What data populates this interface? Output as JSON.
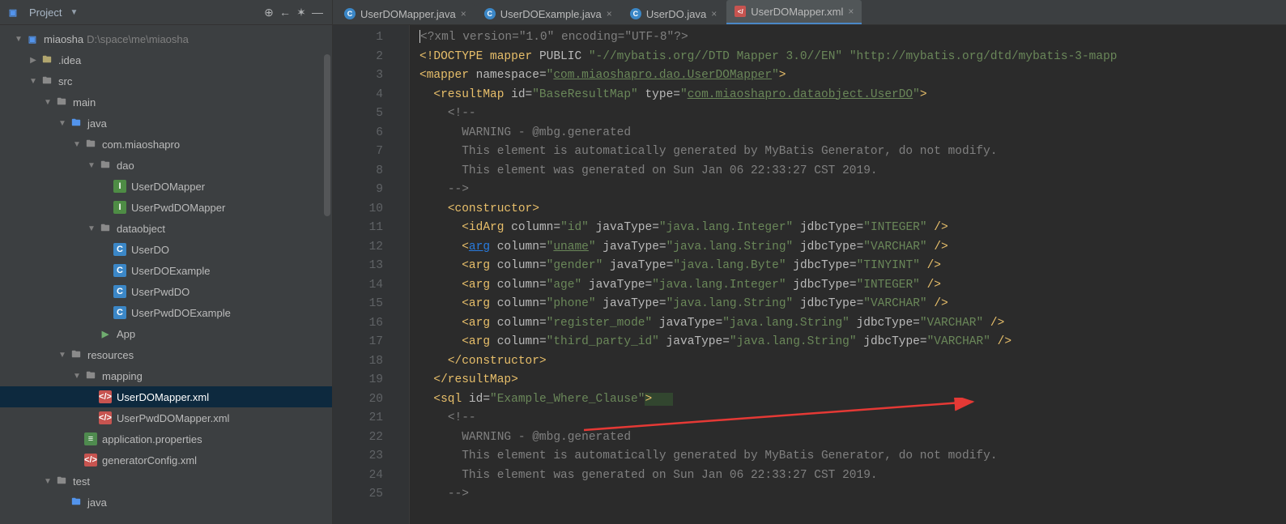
{
  "panel": {
    "title": "Project",
    "toolbar": {
      "target": "⊕",
      "back": "←",
      "gear": "✶",
      "min": "—"
    }
  },
  "tree": [
    {
      "d": 0,
      "exp": "▼",
      "icon": "mod",
      "label": "miaosha",
      "path": "D:\\space\\me\\miaosha",
      "sel": false
    },
    {
      "d": 1,
      "exp": "▶",
      "icon": "folderx",
      "label": ".idea"
    },
    {
      "d": 1,
      "exp": "▼",
      "icon": "folder",
      "label": "src"
    },
    {
      "d": 2,
      "exp": "▼",
      "icon": "folder",
      "label": "main"
    },
    {
      "d": 3,
      "exp": "▼",
      "icon": "folderb",
      "label": "java"
    },
    {
      "d": 4,
      "exp": "▼",
      "icon": "pkg",
      "label": "com.miaoshapro"
    },
    {
      "d": 5,
      "exp": "▼",
      "icon": "pkg",
      "label": "dao"
    },
    {
      "d": 6,
      "exp": "",
      "icon": "j",
      "label": "UserDOMapper"
    },
    {
      "d": 6,
      "exp": "",
      "icon": "j",
      "label": "UserPwdDOMapper"
    },
    {
      "d": 5,
      "exp": "▼",
      "icon": "pkg",
      "label": "dataobject"
    },
    {
      "d": 6,
      "exp": "",
      "icon": "c",
      "label": "UserDO"
    },
    {
      "d": 6,
      "exp": "",
      "icon": "c",
      "label": "UserDOExample"
    },
    {
      "d": 6,
      "exp": "",
      "icon": "c",
      "label": "UserPwdDO"
    },
    {
      "d": 6,
      "exp": "",
      "icon": "c",
      "label": "UserPwdDOExample"
    },
    {
      "d": 5,
      "exp": "",
      "icon": "app",
      "label": "App"
    },
    {
      "d": 3,
      "exp": "▼",
      "icon": "pkg",
      "label": "resources"
    },
    {
      "d": 4,
      "exp": "▼",
      "icon": "pkg",
      "label": "mapping"
    },
    {
      "d": 5,
      "exp": "",
      "icon": "x",
      "label": "UserDOMapper.xml",
      "sel": true
    },
    {
      "d": 5,
      "exp": "",
      "icon": "x",
      "label": "UserPwdDOMapper.xml"
    },
    {
      "d": 4,
      "exp": "",
      "icon": "prop",
      "label": "application.properties"
    },
    {
      "d": 4,
      "exp": "",
      "icon": "x",
      "label": "generatorConfig.xml"
    },
    {
      "d": 2,
      "exp": "▼",
      "icon": "folder",
      "label": "test"
    },
    {
      "d": 3,
      "exp": "",
      "icon": "folderb",
      "label": "java"
    }
  ],
  "tabs": [
    {
      "icon": "j",
      "label": "UserDOMapper.java",
      "active": false
    },
    {
      "icon": "j",
      "label": "UserDOExample.java",
      "active": false
    },
    {
      "icon": "j",
      "label": "UserDO.java",
      "active": false
    },
    {
      "icon": "x",
      "label": "UserDOMapper.xml",
      "active": true
    }
  ],
  "gutter": {
    "start": 1,
    "end": 25
  },
  "code": [
    {
      "n": 1,
      "t": "pi",
      "txt": "<?xml version=\"1.0\" encoding=\"UTF-8\"?>"
    },
    {
      "n": 2,
      "html": "<span class='tag'>&lt;!DOCTYPE mapper</span> <span class='attr'>PUBLIC</span> <span class='str'>\"-//mybatis.org//DTD Mapper 3.0//EN\"</span> <span class='str'>\"http://mybatis.org/dtd/mybatis-3-mapp</span>"
    },
    {
      "n": 3,
      "html": "<span class='tag'>&lt;mapper</span> <span class='attr'>namespace=</span><span class='str'>\"<span class='underline'>com.miaoshapro.dao.UserDOMapper</span>\"</span><span class='tag'>&gt;</span>"
    },
    {
      "n": 4,
      "html": "  <span class='tag'>&lt;resultMap</span> <span class='attr'>id=</span><span class='str'>\"BaseResultMap\"</span> <span class='attr'>type=</span><span class='str'>\"<span class='underline'>com.miaoshapro.dataobject.UserDO</span>\"</span><span class='tag'>&gt;</span>"
    },
    {
      "n": 5,
      "html": "    <span class='comment'>&lt;!--</span>"
    },
    {
      "n": 6,
      "html": "<span class='comment'>      WARNING - @mbg.generated</span>"
    },
    {
      "n": 7,
      "html": "<span class='comment'>      This element is automatically generated by MyBatis Generator, do not modify.</span>"
    },
    {
      "n": 8,
      "html": "<span class='comment'>      This element was generated on Sun Jan 06 22:33:27 CST 2019.</span>"
    },
    {
      "n": 9,
      "html": "    <span class='comment'>--&gt;</span>"
    },
    {
      "n": 10,
      "html": "    <span class='tag'>&lt;constructor&gt;</span>"
    },
    {
      "n": 11,
      "html": "      <span class='tag'>&lt;idArg</span> <span class='attr'>column=</span><span class='str'>\"id\"</span> <span class='attr'>javaType=</span><span class='str'>\"java.lang.Integer\"</span> <span class='attr'>jdbcType=</span><span class='str'>\"INTEGER\"</span> <span class='tag'>/&gt;</span>"
    },
    {
      "n": 12,
      "html": "      <span class='tag'>&lt;</span><span class='link'>arg</span> <span class='attr'>column=</span><span class='str'>\"<span class='underline'>uname</span>\"</span> <span class='attr'>javaType=</span><span class='str'>\"java.lang.String\"</span> <span class='attr'>jdbcType=</span><span class='str'>\"VARCHAR\"</span> <span class='tag'>/&gt;</span>"
    },
    {
      "n": 13,
      "html": "      <span class='tag'>&lt;arg</span> <span class='attr'>column=</span><span class='str'>\"gender\"</span> <span class='attr'>javaType=</span><span class='str'>\"java.lang.Byte\"</span> <span class='attr'>jdbcType=</span><span class='str'>\"TINYINT\"</span> <span class='tag'>/&gt;</span>"
    },
    {
      "n": 14,
      "html": "      <span class='tag'>&lt;arg</span> <span class='attr'>column=</span><span class='str'>\"age\"</span> <span class='attr'>javaType=</span><span class='str'>\"java.lang.Integer\"</span> <span class='attr'>jdbcType=</span><span class='str'>\"INTEGER\"</span> <span class='tag'>/&gt;</span>"
    },
    {
      "n": 15,
      "html": "      <span class='tag'>&lt;arg</span> <span class='attr'>column=</span><span class='str'>\"phone\"</span> <span class='attr'>javaType=</span><span class='str'>\"java.lang.String\"</span> <span class='attr'>jdbcType=</span><span class='str'>\"VARCHAR\"</span> <span class='tag'>/&gt;</span>"
    },
    {
      "n": 16,
      "html": "      <span class='tag'>&lt;arg</span> <span class='attr'>column=</span><span class='str'>\"register_mode\"</span> <span class='attr'>javaType=</span><span class='str'>\"java.lang.String\"</span> <span class='attr'>jdbcType=</span><span class='str'>\"VARCHAR\"</span> <span class='tag'>/&gt;</span>"
    },
    {
      "n": 17,
      "html": "      <span class='tag'>&lt;arg</span> <span class='attr'>column=</span><span class='str'>\"third_party_id\"</span> <span class='attr'>javaType=</span><span class='str'>\"java.lang.String\"</span> <span class='attr'>jdbcType=</span><span class='str'>\"VARCHAR\"</span> <span class='tag'>/&gt;</span>"
    },
    {
      "n": 18,
      "html": "    <span class='tag'>&lt;/constructor&gt;</span>"
    },
    {
      "n": 19,
      "html": "  <span class='tag'>&lt;/resultMap&gt;</span>"
    },
    {
      "n": 20,
      "html": "  <span class='tag'>&lt;sql</span> <span class='attr'>id=</span><span class='str'>\"Example_Where_Clause\"</span><span class='hl-sql'><span class='tag'>&gt;</span>   </span>"
    },
    {
      "n": 21,
      "html": "    <span class='comment'>&lt;!--</span>"
    },
    {
      "n": 22,
      "html": "<span class='comment'>      WARNING - @mbg.generated</span>"
    },
    {
      "n": 23,
      "html": "<span class='comment'>      This element is automatically generated by MyBatis Generator, do not modify.</span>"
    },
    {
      "n": 24,
      "html": "<span class='comment'>      This element was generated on Sun Jan 06 22:33:27 CST 2019.</span>"
    },
    {
      "n": 25,
      "html": "    <span class='comment'>--&gt;</span>"
    }
  ]
}
